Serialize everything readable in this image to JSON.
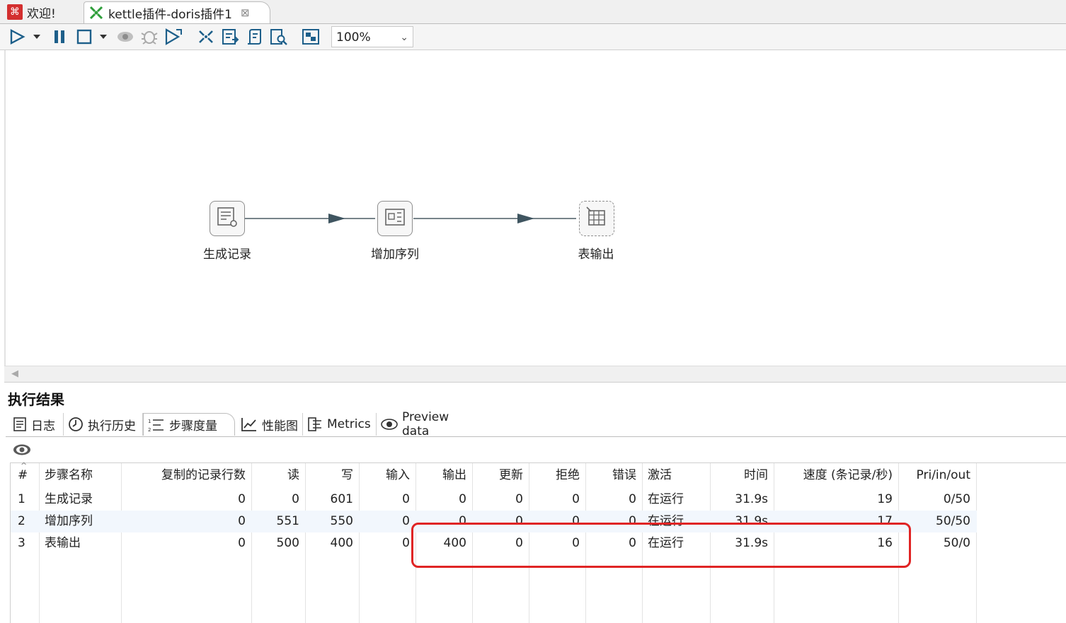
{
  "tabs": {
    "welcome": "欢迎!",
    "active": "kettle插件-doris插件1",
    "close_glyph": "⊠"
  },
  "toolbar": {
    "zoom": "100%",
    "icons": [
      "run-icon",
      "run-dropdown-icon",
      "pause-icon",
      "stop-icon",
      "stop-dropdown-icon",
      "preview-icon",
      "debug-icon",
      "replay-icon",
      "impact-icon",
      "sql-icon",
      "check-icon",
      "analyze-icon",
      "grid-toggle-icon"
    ]
  },
  "canvas": {
    "steps": [
      {
        "label": "生成记录",
        "icon": "generate-rows-icon"
      },
      {
        "label": "增加序列",
        "icon": "add-sequence-icon"
      },
      {
        "label": "表输出",
        "icon": "table-output-icon"
      }
    ]
  },
  "results": {
    "title": "执行结果",
    "tabs": [
      {
        "label": "日志",
        "icon": "log-icon"
      },
      {
        "label": "执行历史",
        "icon": "history-icon"
      },
      {
        "label": "步骤度量",
        "icon": "step-metrics-icon"
      },
      {
        "label": "性能图",
        "icon": "performance-graph-icon"
      },
      {
        "label": "Metrics",
        "icon": "metrics-icon"
      },
      {
        "label": "Preview data",
        "icon": "eye-icon"
      }
    ],
    "columns": [
      "#",
      "步骤名称",
      "复制的记录行数",
      "读",
      "写",
      "输入",
      "输出",
      "更新",
      "拒绝",
      "错误",
      "激活",
      "时间",
      "速度 (条记录/秒)",
      "Pri/in/out"
    ],
    "rows": [
      [
        "1",
        "生成记录",
        "0",
        "0",
        "601",
        "0",
        "0",
        "0",
        "0",
        "0",
        "在运行",
        "31.9s",
        "19",
        "0/50"
      ],
      [
        "2",
        "增加序列",
        "0",
        "551",
        "550",
        "0",
        "0",
        "0",
        "0",
        "0",
        "在运行",
        "31.9s",
        "17",
        "50/50"
      ],
      [
        "3",
        "表输出",
        "0",
        "500",
        "400",
        "0",
        "400",
        "0",
        "0",
        "0",
        "在运行",
        "31.9s",
        "16",
        "50/0"
      ]
    ],
    "highlight_color": "#e02424"
  }
}
